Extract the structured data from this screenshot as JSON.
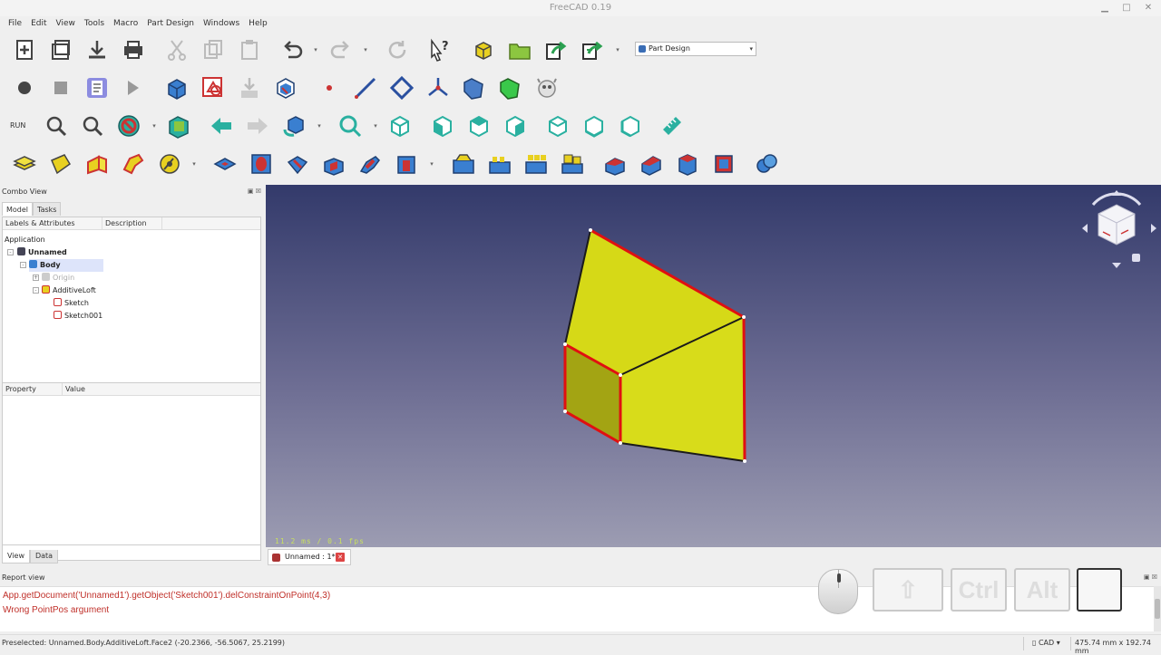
{
  "window": {
    "title": "FreeCAD 0.19"
  },
  "menu": [
    "File",
    "Edit",
    "View",
    "Tools",
    "Macro",
    "Part Design",
    "Windows",
    "Help"
  ],
  "workbench": {
    "selected": "Part Design"
  },
  "toolbar": {
    "run_label": "RUN"
  },
  "combo_view": {
    "title": "Combo View",
    "tabs": [
      "Model",
      "Tasks"
    ],
    "tree_columns": [
      "Labels & Attributes",
      "Description"
    ],
    "tree": {
      "root": "Application",
      "document": "Unnamed",
      "body": "Body",
      "origin": "Origin",
      "feature": "AdditiveLoft",
      "sketches": [
        "Sketch",
        "Sketch001"
      ]
    },
    "property_columns": [
      "Property",
      "Value"
    ],
    "bottom_tabs": [
      "View",
      "Data"
    ]
  },
  "viewport": {
    "fps": "11.2 ms / 0.1 fps"
  },
  "document_tab": {
    "label": "Unnamed : 1*"
  },
  "report_view": {
    "title": "Report view",
    "lines": [
      "App.getDocument('Unnamed1').getObject('Sketch001').delConstraintOnPoint(4,3)",
      "Wrong PointPos argument"
    ]
  },
  "key_overlay": {
    "keys": [
      "Ctrl",
      "Alt"
    ]
  },
  "status": {
    "preselected": "Preselected: Unnamed.Body.AdditiveLoft.Face2 (-20.2366, -56.5067, 25.2199)",
    "nav_style": "CAD",
    "dimensions": "475.74 mm x 192.74 mm"
  },
  "colors": {
    "viewport_top": "#333a6b",
    "shape_yellow": "#d8dc17",
    "edge_red": "#e01010",
    "error_text": "#c0302a"
  }
}
